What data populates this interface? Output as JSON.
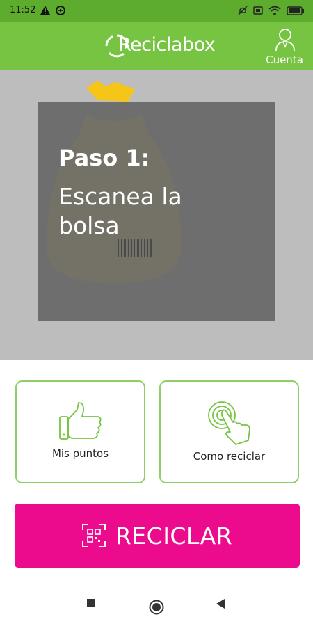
{
  "status_bar": {
    "time": "11:52",
    "icons": [
      "warning-icon",
      "sync-icon",
      "mute-icon",
      "screen-icon",
      "wifi-icon",
      "battery-icon"
    ]
  },
  "header": {
    "logo_text": "Reciclabox",
    "account_label": "Cuenta"
  },
  "instruction": {
    "step_title": "Paso 1:",
    "step_description": "Escanea la bolsa"
  },
  "options": [
    {
      "label": "Mis puntos",
      "icon": "thumbs-up-icon"
    },
    {
      "label": "Como reciclar",
      "icon": "touch-hand-icon"
    }
  ],
  "recycle_button": {
    "label": "RECICLAR",
    "icon": "qr-scan-icon"
  },
  "colors": {
    "status_bar": "#5eac2e",
    "header": "#76c442",
    "accent_pink": "#ec0b8c",
    "option_border": "#8ed064",
    "bag_tie": "#f5c518"
  },
  "nav": [
    "recent-apps-icon",
    "home-icon",
    "back-icon"
  ]
}
